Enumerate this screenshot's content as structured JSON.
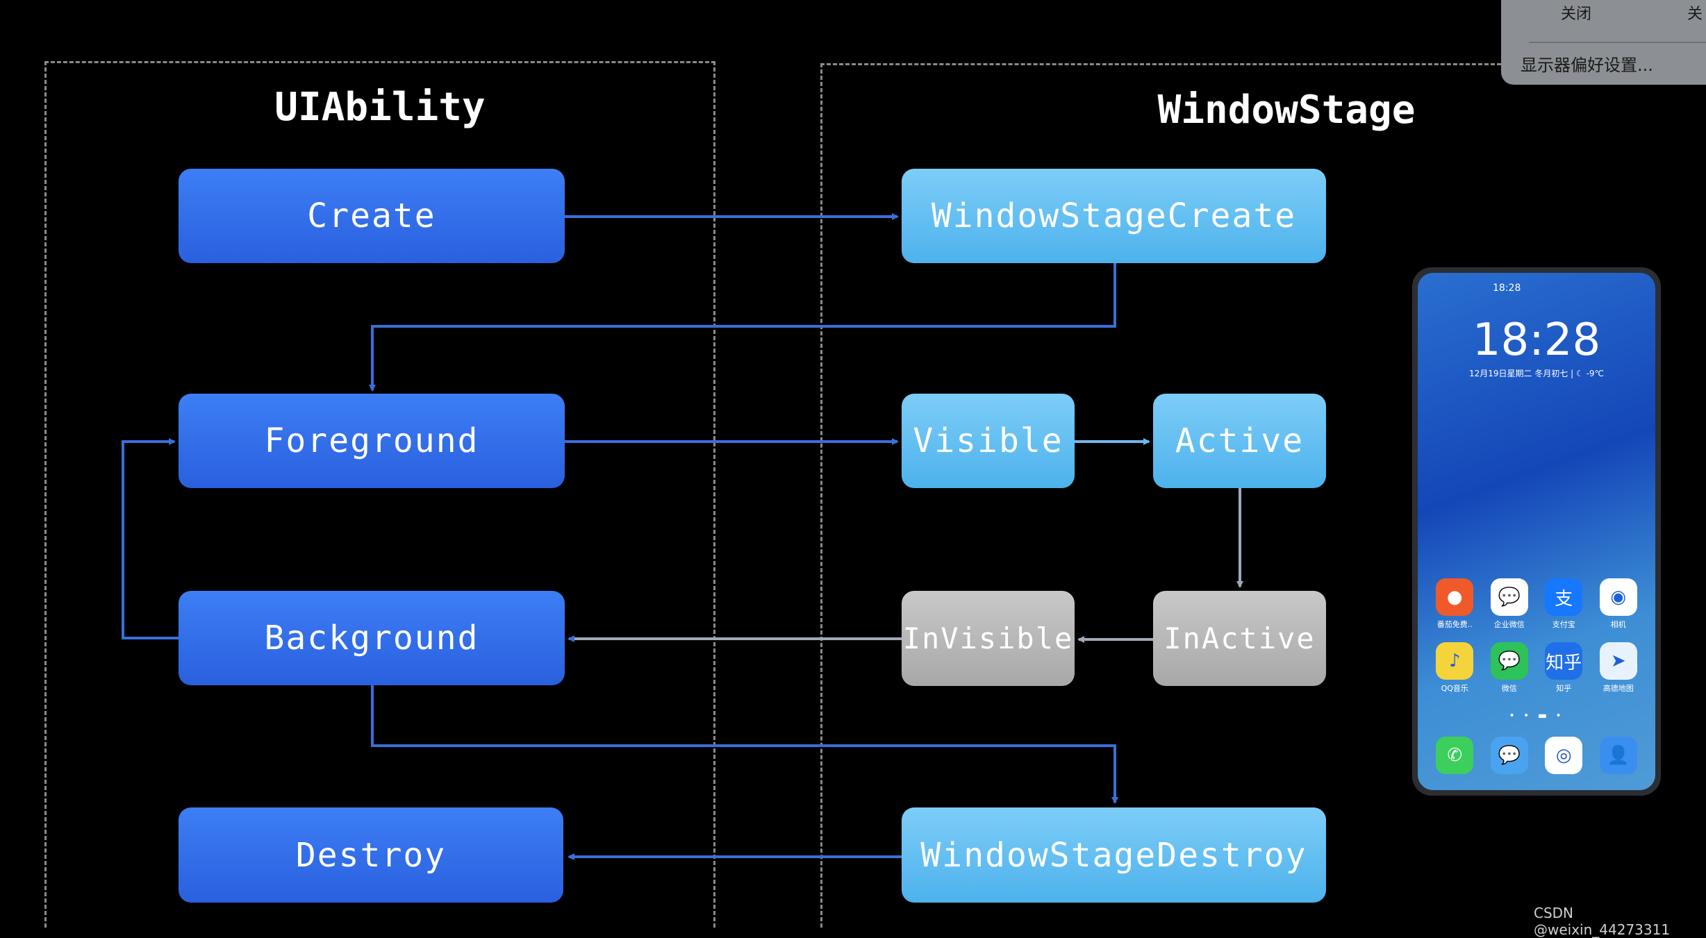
{
  "sections": {
    "left_title": "UIAbility",
    "right_title": "WindowStage"
  },
  "nodes": {
    "create": "Create",
    "foreground": "Foreground",
    "background": "Background",
    "destroy": "Destroy",
    "window_stage_create": "WindowStageCreate",
    "visible": "Visible",
    "active": "Active",
    "invisible": "InVisible",
    "inactive": "InActive",
    "window_stage_destroy": "WindowStageDestroy"
  },
  "colors": {
    "ability": "#2f6de6",
    "stage": "#5bbcf0",
    "inactive": "#b8b8b8",
    "arrow": "#3a6fd8",
    "arrow_gray": "#a0a8b8"
  },
  "menu": {
    "item_a": "关闭",
    "item_b": "关",
    "display_prefs": "显示器偏好设置..."
  },
  "phone": {
    "status_time": "18:28",
    "clock": "18:28",
    "date": "12月19日星期二  冬月初七  |  ☾ -9℃",
    "apps": [
      {
        "label": "番茄免费..",
        "icon": "tomato-icon",
        "glyph": "●",
        "bg": "#f05a2a"
      },
      {
        "label": "企业微信",
        "icon": "wecom-icon",
        "glyph": "💬",
        "bg": "#ffffff"
      },
      {
        "label": "支付宝",
        "icon": "alipay-icon",
        "glyph": "支",
        "bg": "#1677ff"
      },
      {
        "label": "相机",
        "icon": "camera-icon",
        "glyph": "◉",
        "bg": "#ffffff"
      },
      {
        "label": "QQ音乐",
        "icon": "qqmusic-icon",
        "glyph": "♪",
        "bg": "#f5d33a"
      },
      {
        "label": "微信",
        "icon": "wechat-icon",
        "glyph": "💬",
        "bg": "#2dc25a"
      },
      {
        "label": "知乎",
        "icon": "zhihu-icon",
        "glyph": "知乎",
        "bg": "#1f6fe8"
      },
      {
        "label": "高德地图",
        "icon": "amap-icon",
        "glyph": "➤",
        "bg": "#e8f2ff"
      }
    ],
    "dock": [
      {
        "icon": "phone-icon",
        "glyph": "✆",
        "bg": "#3ccf5c"
      },
      {
        "icon": "messages-icon",
        "glyph": "💬",
        "bg": "#4aa3f0"
      },
      {
        "icon": "browser-icon",
        "glyph": "◎",
        "bg": "#ffffff"
      },
      {
        "icon": "contacts-icon",
        "glyph": "👤",
        "bg": "#3a8ef0"
      }
    ]
  },
  "watermark": "CSDN @weixin_44273311"
}
